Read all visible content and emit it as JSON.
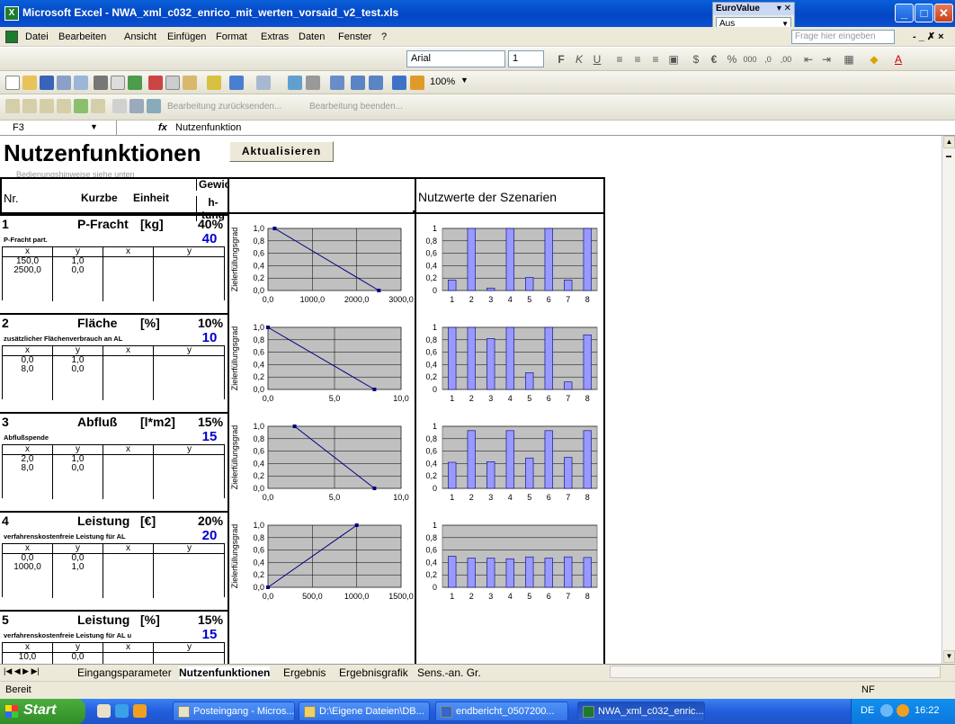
{
  "window": {
    "title": "Microsoft Excel - NWA_xml_c032_enrico_mit_werten_vorsaid_v2_test.xls",
    "min": "_",
    "max": "□",
    "close": "✕"
  },
  "eurovalue": {
    "title": "EuroValue",
    "selected": "Aus"
  },
  "menu": [
    "Datei",
    "Bearbeiten",
    "Ansicht",
    "Einfügen",
    "Format",
    "Extras",
    "Daten",
    "Fenster",
    "?"
  ],
  "help_placeholder": "Frage hier eingeben",
  "format_toolbar": {
    "font": "Arial",
    "size": "1",
    "zoom": "100%"
  },
  "review_toolbar": {
    "reply": "Bearbeitung zurücksenden...",
    "end": "Bearbeitung beenden..."
  },
  "formula_bar": {
    "cell": "F3",
    "fx": "fx",
    "value": "Nutzenfunktion"
  },
  "sheet": {
    "title": "Nutzenfunktionen",
    "hint": "Bedienungshinweise siehe unten",
    "button": "Aktualisieren",
    "col_nr": "Nr.",
    "col_short": "Kurzbe",
    "col_unit": "Einheit",
    "col_weight_1": "Gewic",
    "col_weight_2": "h-tung",
    "col_scenarios": "Nutzwerte der Szenarien",
    "xy_x": "x",
    "xy_y": "y",
    "ylabel": "Zielerfüllungsgrad"
  },
  "functions": [
    {
      "nr": "1",
      "name": "P-Fracht",
      "unit": "[kg]",
      "pct": "40%",
      "weight": "40",
      "desc": "P-Fracht part.",
      "xs": [
        "150,0",
        "2500,0"
      ],
      "ys": [
        "1,0",
        "0,0"
      ]
    },
    {
      "nr": "2",
      "name": "Fläche",
      "unit": "[%]",
      "pct": "10%",
      "weight": "10",
      "desc": "zusätzlicher Flächenverbrauch an AL",
      "xs": [
        "0,0",
        "8,0"
      ],
      "ys": [
        "1,0",
        "0,0"
      ]
    },
    {
      "nr": "3",
      "name": "Abfluß",
      "unit": "[l*m2]",
      "pct": "15%",
      "weight": "15",
      "desc": "Abflußspende",
      "xs": [
        "2,0",
        "8,0"
      ],
      "ys": [
        "1,0",
        "0,0"
      ]
    },
    {
      "nr": "4",
      "name": "Leistung",
      "unit": "[€]",
      "pct": "20%",
      "weight": "20",
      "desc": "verfahrenskostenfreie Leistung für AL",
      "xs": [
        "0,0",
        "1000,0"
      ],
      "ys": [
        "0,0",
        "1,0"
      ]
    },
    {
      "nr": "5",
      "name": "Leistung",
      "unit": "[%]",
      "pct": "15%",
      "weight": "15",
      "desc": "verfahrenskostenfreie Leistung für AL u",
      "xs": [
        "10,0"
      ],
      "ys": [
        "0,0"
      ]
    }
  ],
  "chart_data": [
    {
      "type": "line",
      "xlabel": "",
      "ylabel": "Zielerfüllungsgrad",
      "xlim": [
        0,
        3000
      ],
      "ylim": [
        0,
        1
      ],
      "xticks": [
        "0,0",
        "1000,0",
        "2000,0",
        "3000,0"
      ],
      "yticks": [
        "0,0",
        "0,2",
        "0,4",
        "0,6",
        "0,8",
        "1,0"
      ],
      "x": [
        150,
        2500
      ],
      "y": [
        1,
        0
      ]
    },
    {
      "type": "bar",
      "categories": [
        "1",
        "2",
        "3",
        "4",
        "5",
        "6",
        "7",
        "8"
      ],
      "values": [
        0.17,
        1.0,
        0.04,
        1.0,
        0.21,
        1.0,
        0.17,
        1.0
      ],
      "ylim": [
        0,
        1
      ],
      "yticks": [
        "0",
        "0,2",
        "0,4",
        "0,6",
        "0,8",
        "1"
      ]
    },
    {
      "type": "line",
      "xlabel": "",
      "ylabel": "Zielerfüllungsgrad",
      "xlim": [
        0,
        10
      ],
      "ylim": [
        0,
        1
      ],
      "xticks": [
        "0,0",
        "5,0",
        "10,0"
      ],
      "yticks": [
        "0,0",
        "0,2",
        "0,4",
        "0,6",
        "0,8",
        "1,0"
      ],
      "x": [
        0,
        8
      ],
      "y": [
        1,
        0
      ]
    },
    {
      "type": "bar",
      "categories": [
        "1",
        "2",
        "3",
        "4",
        "5",
        "6",
        "7",
        "8"
      ],
      "values": [
        1.0,
        1.0,
        0.82,
        1.0,
        0.27,
        1.0,
        0.12,
        0.88
      ],
      "ylim": [
        0,
        1
      ],
      "yticks": [
        "0",
        "0,2",
        "0,4",
        "0,6",
        "0,8",
        "1"
      ]
    },
    {
      "type": "line",
      "xlabel": "",
      "ylabel": "Zielerfüllungsgrad",
      "xlim": [
        0,
        10
      ],
      "ylim": [
        0,
        1
      ],
      "xticks": [
        "0,0",
        "5,0",
        "10,0"
      ],
      "yticks": [
        "0,0",
        "0,2",
        "0,4",
        "0,6",
        "0,8",
        "1,0"
      ],
      "x": [
        2,
        8
      ],
      "y": [
        1,
        0
      ]
    },
    {
      "type": "bar",
      "categories": [
        "1",
        "2",
        "3",
        "4",
        "5",
        "6",
        "7",
        "8"
      ],
      "values": [
        0.42,
        0.93,
        0.43,
        0.93,
        0.49,
        0.93,
        0.5,
        0.93
      ],
      "ylim": [
        0,
        1
      ],
      "yticks": [
        "0",
        "0,2",
        "0,4",
        "0,6",
        "0,8",
        "1"
      ]
    },
    {
      "type": "line",
      "xlabel": "",
      "ylabel": "Zielerfüllungsgrad",
      "xlim": [
        0,
        1500
      ],
      "ylim": [
        0,
        1
      ],
      "xticks": [
        "0,0",
        "500,0",
        "1000,0",
        "1500,0"
      ],
      "yticks": [
        "0,0",
        "0,2",
        "0,4",
        "0,6",
        "0,8",
        "1,0"
      ],
      "x": [
        0,
        1000
      ],
      "y": [
        0,
        1
      ]
    },
    {
      "type": "bar",
      "categories": [
        "1",
        "2",
        "3",
        "4",
        "5",
        "6",
        "7",
        "8"
      ],
      "values": [
        0.5,
        0.47,
        0.47,
        0.46,
        0.49,
        0.47,
        0.49,
        0.48
      ],
      "ylim": [
        0,
        1
      ],
      "yticks": [
        "0",
        "0,2",
        "0,4",
        "0,6",
        "0,8",
        "1"
      ]
    }
  ],
  "tabs": [
    "Eingangsparameter",
    "Nutzenfunktionen",
    "Ergebnis",
    "Ergebnisgrafik",
    "Sens.-an. Gr."
  ],
  "status": {
    "left": "Bereit",
    "right": "NF"
  },
  "taskbar": {
    "start": "Start",
    "items": [
      "Posteingang - Micros...",
      "D:\\Eigene Dateien\\DB...",
      "endbericht_0507200...",
      "NWA_xml_c032_enric..."
    ],
    "lang": "DE",
    "clock": "16:22"
  },
  "colors": {
    "title_bar": "#0a5fd8",
    "bar_fill": "#9999ff",
    "plot_bg": "#c0c0c0",
    "weight_blue": "#0000cc"
  }
}
